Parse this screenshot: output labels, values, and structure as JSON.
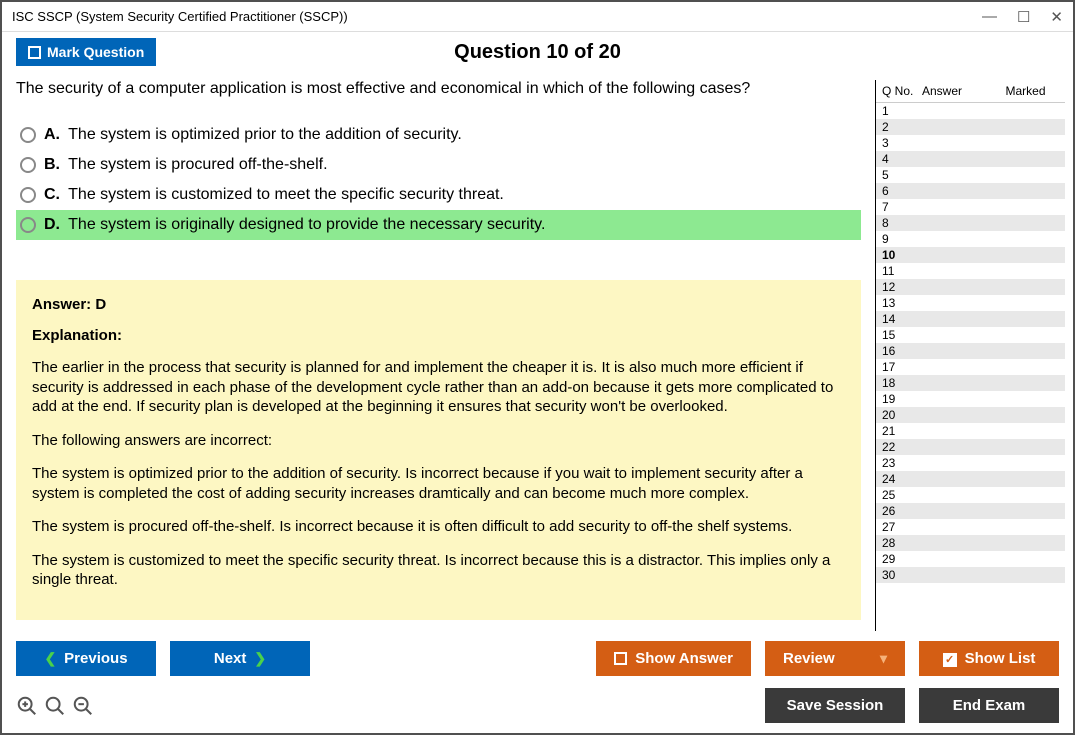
{
  "window": {
    "title": "ISC SSCP (System Security Certified Practitioner (SSCP))"
  },
  "header": {
    "mark_label": "Mark Question",
    "question_heading": "Question 10 of 20"
  },
  "question": {
    "text": "The security of a computer application is most effective and economical in which of the following cases?",
    "options": [
      {
        "letter": "A.",
        "text": "The system is optimized prior to the addition of security.",
        "selected": false
      },
      {
        "letter": "B.",
        "text": "The system is procured off-the-shelf.",
        "selected": false
      },
      {
        "letter": "C.",
        "text": "The system is customized to meet the specific security threat.",
        "selected": false
      },
      {
        "letter": "D.",
        "text": "The system is originally designed to provide the necessary security.",
        "selected": true
      }
    ]
  },
  "answer": {
    "title": "Answer: D",
    "expl_title": "Explanation:",
    "p1": "The earlier in the process that security is planned for and implement the cheaper it is. It is also much more efficient if security is addressed in each phase of the development cycle rather than an add-on because it gets more complicated to add at the end. If security plan is developed at the beginning it ensures that security won't be overlooked.",
    "p2": "The following answers are incorrect:",
    "p3": "The system is optimized prior to the addition of security. Is incorrect because if you wait to implement security after a system is completed the cost of adding security increases dramtically and can become much more complex.",
    "p4": "The system is procured off-the-shelf. Is incorrect because it is often difficult to add security to off-the shelf systems.",
    "p5": "The system is customized to meet the specific security threat. Is incorrect because this is a distractor. This implies only a single threat."
  },
  "side": {
    "col_qno": "Q No.",
    "col_ans": "Answer",
    "col_mark": "Marked",
    "total": 30,
    "current": 10
  },
  "footer": {
    "prev": "Previous",
    "next": "Next",
    "show_answer": "Show Answer",
    "review": "Review",
    "show_list": "Show List",
    "save_session": "Save Session",
    "end_exam": "End Exam"
  }
}
